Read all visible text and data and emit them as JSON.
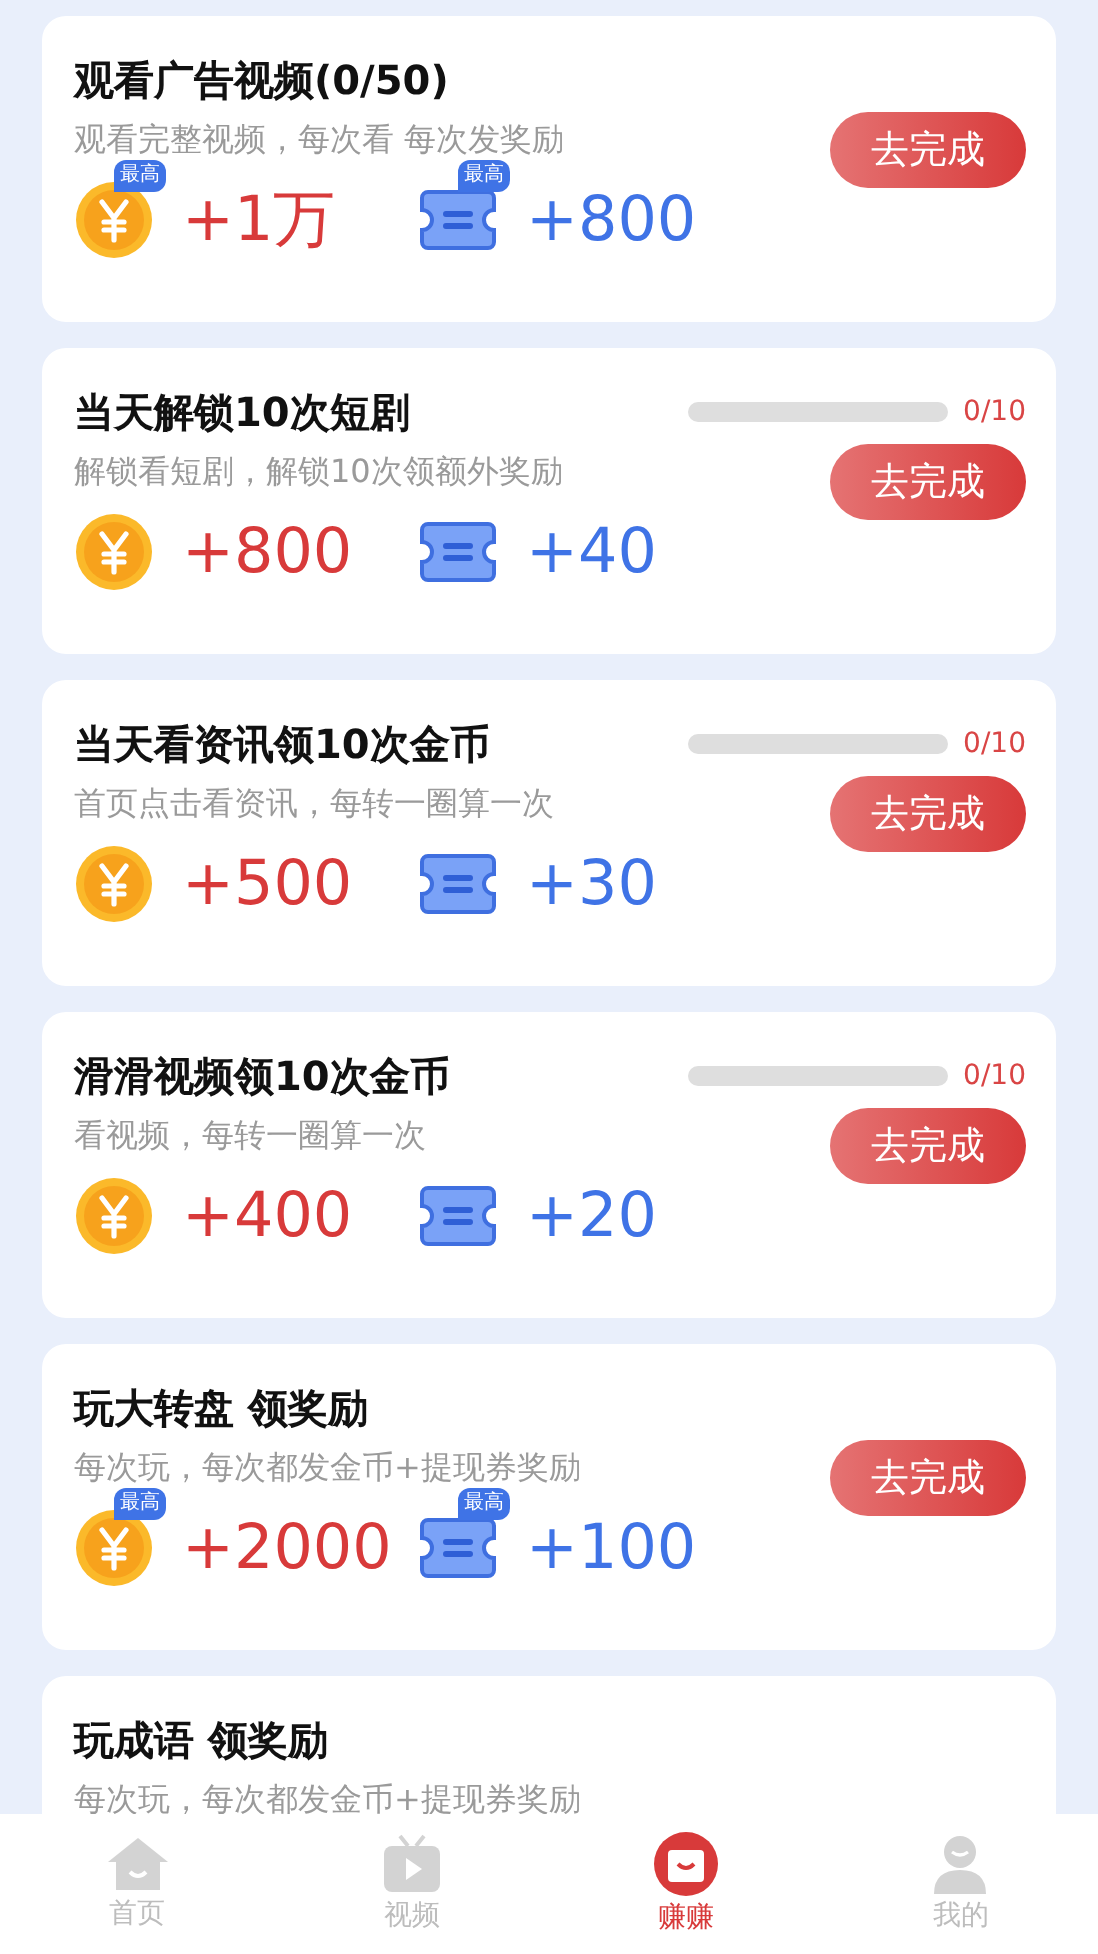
{
  "tasks": [
    {
      "title": "观看广告视频(0/50)",
      "description": "观看完整视频，每次看 每次发奖励",
      "button": "去完成",
      "rewards": [
        {
          "kind": "coin",
          "amount": "+1万",
          "badge": "最高"
        },
        {
          "kind": "ticket",
          "amount": "+800",
          "badge": "最高"
        }
      ]
    },
    {
      "title": "当天解锁10次短剧",
      "description": "解锁看短剧，解锁10次领额外奖励",
      "button": "去完成",
      "progress": {
        "level": 0,
        "text": "0/10"
      },
      "rewards": [
        {
          "kind": "coin",
          "amount": "+800"
        },
        {
          "kind": "ticket",
          "amount": "+40"
        }
      ]
    },
    {
      "title": "当天看资讯领10次金币",
      "description": "首页点击看资讯，每转一圈算一次",
      "button": "去完成",
      "progress": {
        "level": 0,
        "text": "0/10"
      },
      "rewards": [
        {
          "kind": "coin",
          "amount": "+500"
        },
        {
          "kind": "ticket",
          "amount": "+30"
        }
      ]
    },
    {
      "title": "滑滑视频领10次金币",
      "description": "看视频，每转一圈算一次",
      "button": "去完成",
      "progress": {
        "level": 0,
        "text": "0/10"
      },
      "rewards": [
        {
          "kind": "coin",
          "amount": "+400"
        },
        {
          "kind": "ticket",
          "amount": "+20"
        }
      ]
    },
    {
      "title": "玩大转盘 领奖励",
      "description": "每次玩，每次都发金币+提现券奖励",
      "button": "去完成",
      "rewards": [
        {
          "kind": "coin",
          "amount": "+2000",
          "badge": "最高"
        },
        {
          "kind": "ticket",
          "amount": "+100",
          "badge": "最高"
        }
      ]
    },
    {
      "title": "玩成语 领奖励",
      "description": "每次玩，每次都发金币+提现券奖励"
    }
  ],
  "nav": [
    {
      "kind": "home",
      "label": "首页",
      "selected": false
    },
    {
      "kind": "video",
      "label": "视频",
      "selected": false
    },
    {
      "kind": "earn",
      "label": "赚赚",
      "selected": true
    },
    {
      "kind": "profile",
      "label": "我的",
      "selected": false
    }
  ]
}
